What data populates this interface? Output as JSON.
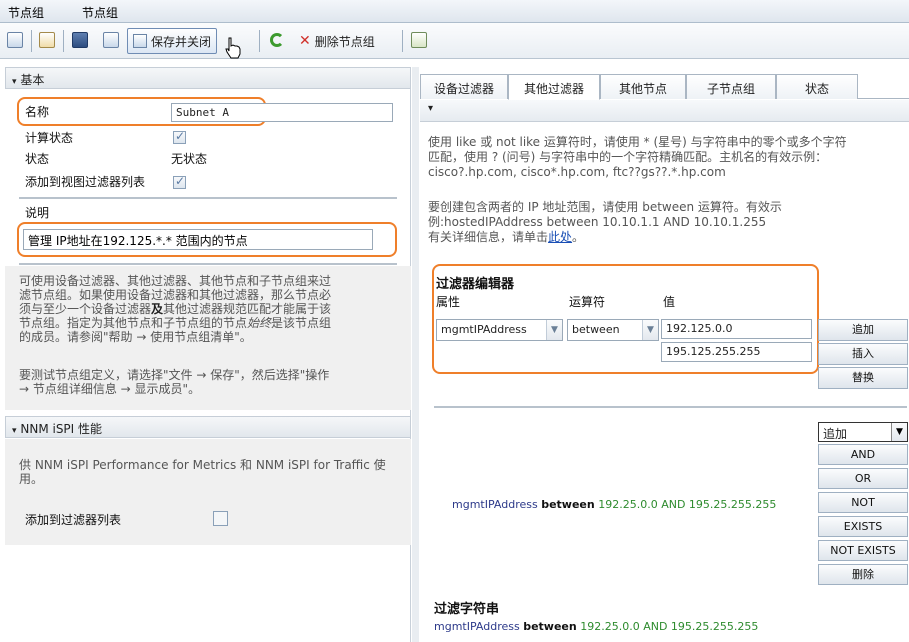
{
  "menu": {
    "item1": "节点组",
    "item2": "节点组"
  },
  "toolbar": {
    "save_close_label": "保存并关闭",
    "delete_label": "删除节点组"
  },
  "basic": {
    "header": "基本",
    "name_label": "名称",
    "name_value": "Subnet A",
    "calc_status_label": "计算状态",
    "status_label": "状态",
    "status_value": "无状态",
    "add_view_filter_label": "添加到视图过滤器列表",
    "desc_label": "说明",
    "desc_value": "管理 IP地址在192.125.*.* 范围内的节点",
    "hint1_line1": "可使用设备过滤器、其他过滤器、其他节点和子节点组来过",
    "hint1_line2": "滤节点组。如果使用设备过滤器和其他过滤器，那么节点必",
    "hint1_line3_a": "须与至少一个设备过滤器",
    "hint1_line3_b": "及",
    "hint1_line3_c": "其他过滤器规范匹配才能属于该",
    "hint1_line4_a": "节点组。指定为其他节点和子节点组的节点",
    "hint1_line4_b": "始终",
    "hint1_line4_c": "是该节点组",
    "hint1_line5": "的成员。请参阅\"帮助 → 使用节点组清单\"。",
    "hint2_line1": "要测试节点组定义，请选择\"文件 → 保存\"，然后选择\"操作",
    "hint2_line2": "→ 节点组详细信息 → 显示成员\"。"
  },
  "nnm": {
    "header": "NNM iSPI 性能",
    "hint_line1": "供 NNM iSPI Performance for Metrics 和 NNM iSPI for Traffic 使",
    "hint_line2": "用。",
    "add_filter_label": "添加到过滤器列表"
  },
  "tabs": [
    "设备过滤器",
    "其他过滤器",
    "其他节点",
    "子节点组",
    "状态"
  ],
  "right": {
    "help1_line1": "使用 like 或 not like 运算符时，请使用 * (星号) 与字符串中的零个或多个字符",
    "help1_line2": "匹配，使用 ? (问号) 与字符串中的一个字符精确匹配。主机名的有效示例：",
    "help1_line3": "cisco?.hp.com, cisco*.hp.com, ftc??gs??.*.hp.com",
    "help2_line1": "要创建包含两者的 IP 地址范围，请使用 between 运算符。有效示",
    "help2_line2": "例:hostedIPAddress between 10.10.1.1 AND 10.10.1.255",
    "help2_line3_a": "有关详细信息，请单击",
    "help2_line3_link": "此处",
    "help2_line3_b": "。",
    "editor_title": "过滤器编辑器",
    "col_attr": "属性",
    "col_op": "运算符",
    "col_value": "值",
    "attr_value": "mgmtIPAddress",
    "op_value": "between",
    "value1": "192.125.0.0",
    "value2": "195.125.255.255",
    "btn_add": "追加",
    "btn_insert": "插入",
    "btn_replace": "替换",
    "logic_select": "追加",
    "btn_and": "AND",
    "btn_or": "OR",
    "btn_not": "NOT",
    "btn_exists": "EXISTS",
    "btn_not_exists": "NOT EXISTS",
    "btn_delete": "删除",
    "expr_attr": "mgmtIPAddress",
    "expr_op": "between",
    "expr_rest": "192.25.0.0 AND 195.25.255.255",
    "filter_string_title": "过滤字符串",
    "fs_attr": "mgmtIPAddress",
    "fs_op": "between",
    "fs_rest": "192.25.0.0 AND 195.25.255.255"
  }
}
